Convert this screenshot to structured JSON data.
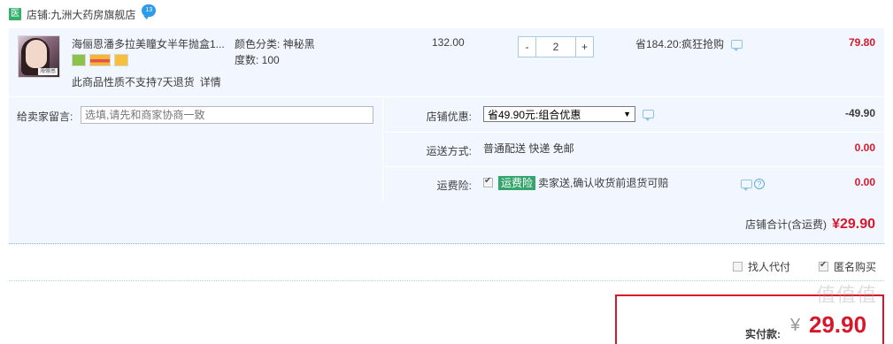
{
  "shop": {
    "icon_text": "医",
    "label": "店铺:",
    "name": "九洲大药房旗舰店",
    "chat_badge": "13"
  },
  "item": {
    "title": "海俪恩潘多拉美瞳女半年抛盒1...",
    "thumb_label": "海俪恩",
    "color_label": "颜色分类: 神秘黑",
    "degree_label": "度数: 100",
    "return_note": "此商品性质不支持7天退货",
    "detail_link": "详情",
    "price": "132.00",
    "qty_minus": "-",
    "qty_value": "2",
    "qty_plus": "+",
    "promo": "省184.20:疯狂抢购",
    "total": "79.80"
  },
  "note": {
    "label": "给卖家留言:",
    "placeholder": "选填,请先和商家协商一致"
  },
  "shop_discount": {
    "label": "店铺优惠:",
    "selected": "省49.90元:组合优惠",
    "amount": "-49.90"
  },
  "shipping": {
    "label": "运送方式:",
    "value": "普通配送 快递 免邮",
    "amount": "0.00"
  },
  "insurance": {
    "label": "运费险:",
    "tag": "运费险",
    "text": "卖家送,确认收货前退货可赔",
    "help": "?",
    "amount": "0.00"
  },
  "shop_total": {
    "label": "店铺合计(含运费)",
    "value": "¥29.90"
  },
  "options": {
    "proxy_pay": "找人代付",
    "anonymous": "匿名购买"
  },
  "payment": {
    "label": "实付款:",
    "currency": "¥",
    "value": "29.90"
  },
  "watermark": "值值值",
  "colors": {
    "price_red": "#d8172b",
    "panel_bg": "#f2f7ff",
    "shop_green": "#35b06a",
    "insurance_green": "#35a56b"
  }
}
